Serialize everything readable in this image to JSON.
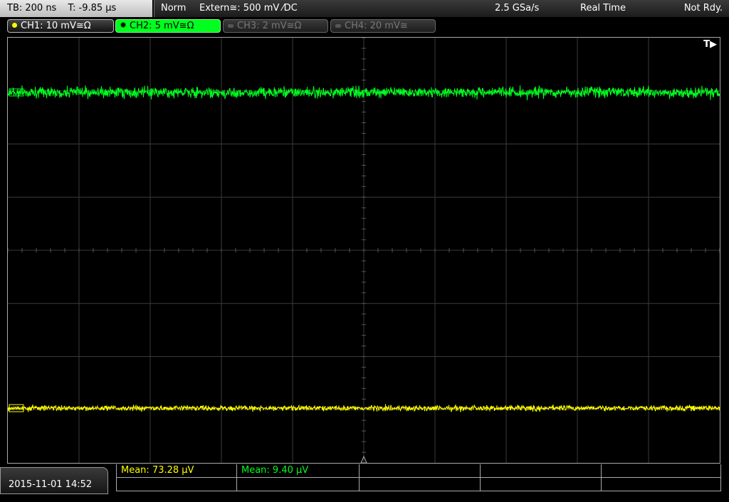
{
  "timebase": {
    "tb": "TB: 200 ns",
    "trig_time": "T: -9.85 µs"
  },
  "status": {
    "mode": "Norm",
    "trigger": "Extern≅: 500 mV ⁄DC",
    "sample_rate": "2.5 GSa/s",
    "acq": "Real Time",
    "state": "Not Rdy."
  },
  "channels": [
    {
      "label": "CH1: 10 mV≅Ω",
      "color": "#ffff00",
      "active": true,
      "selected": false
    },
    {
      "label": "CH2: 5 mV≅Ω",
      "color": "#00ff1e",
      "active": true,
      "selected": true
    },
    {
      "label": "CH3: 2 mV≅Ω",
      "color": "#777777",
      "active": false,
      "selected": false
    },
    {
      "label": "CH4: 20 mV≅",
      "color": "#777777",
      "active": false,
      "selected": false
    }
  ],
  "trigger_marker": "T▶",
  "datetime": "2015-11-01 14:52",
  "measurements": [
    {
      "label": "Mean: 73.28 µV",
      "color": "#ffff00"
    },
    {
      "label": "Mean: 9.40 µV",
      "color": "#00ff1e"
    }
  ],
  "chart_data": {
    "type": "line",
    "grid": {
      "x_divisions": 10,
      "y_divisions": 8
    },
    "series": [
      {
        "channel": "CH2",
        "color": "#00ff1e",
        "level_div": 2.97,
        "noise_div": 0.1
      },
      {
        "channel": "CH1",
        "color": "#ffff00",
        "level_div": -2.97,
        "noise_div": 0.05
      }
    ]
  }
}
